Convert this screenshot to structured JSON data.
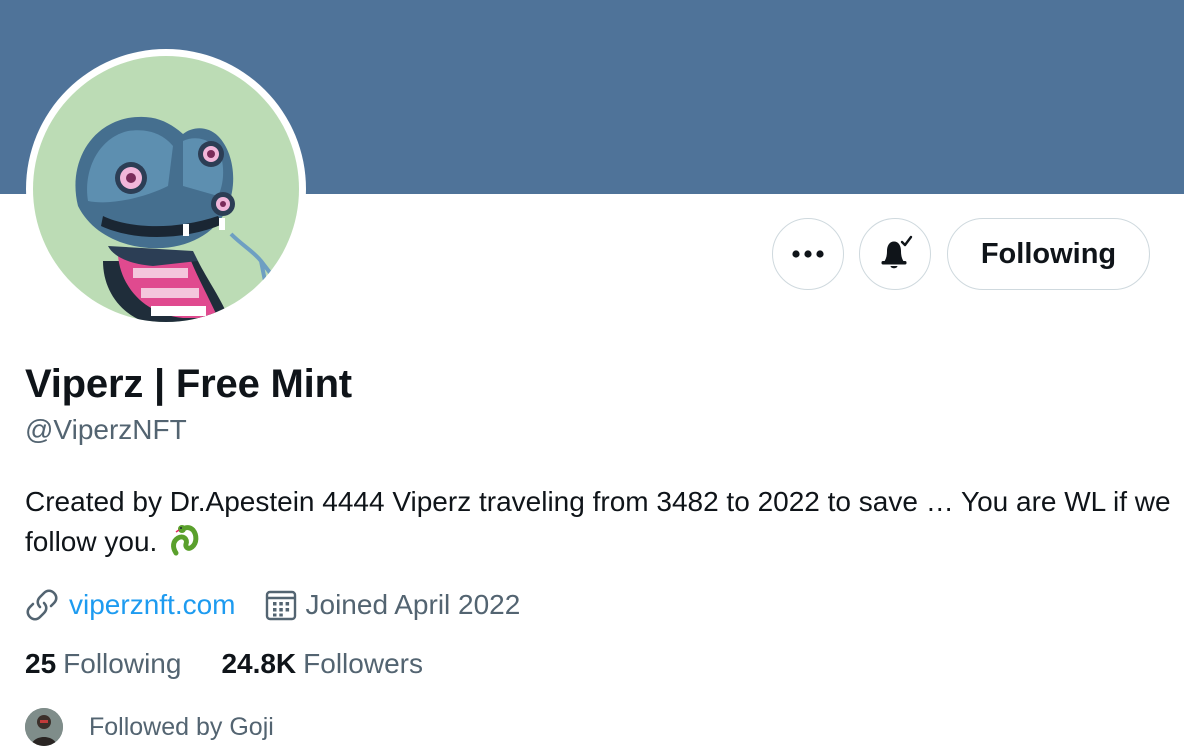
{
  "profile": {
    "display_name": "Viperz | Free Mint",
    "handle": "@ViperzNFT",
    "bio": "Created by Dr.Apestein 4444 Viperz traveling from 3482 to 2022 to save … You are WL if we follow you.",
    "website": "viperznft.com",
    "joined": "Joined April 2022",
    "following_count": "25",
    "following_label": "Following",
    "followers_count": "24.8K",
    "followers_label": "Followers",
    "followed_by": "Followed by Goji"
  },
  "actions": {
    "more_icon": "more-dots-icon",
    "bell_icon": "notifications-on-bell-icon",
    "follow_button_label": "Following"
  },
  "colors": {
    "banner": "#4f7399",
    "avatar_bg": "#bcdcb5",
    "link": "#1d9bf0",
    "secondary_text": "#536471"
  }
}
